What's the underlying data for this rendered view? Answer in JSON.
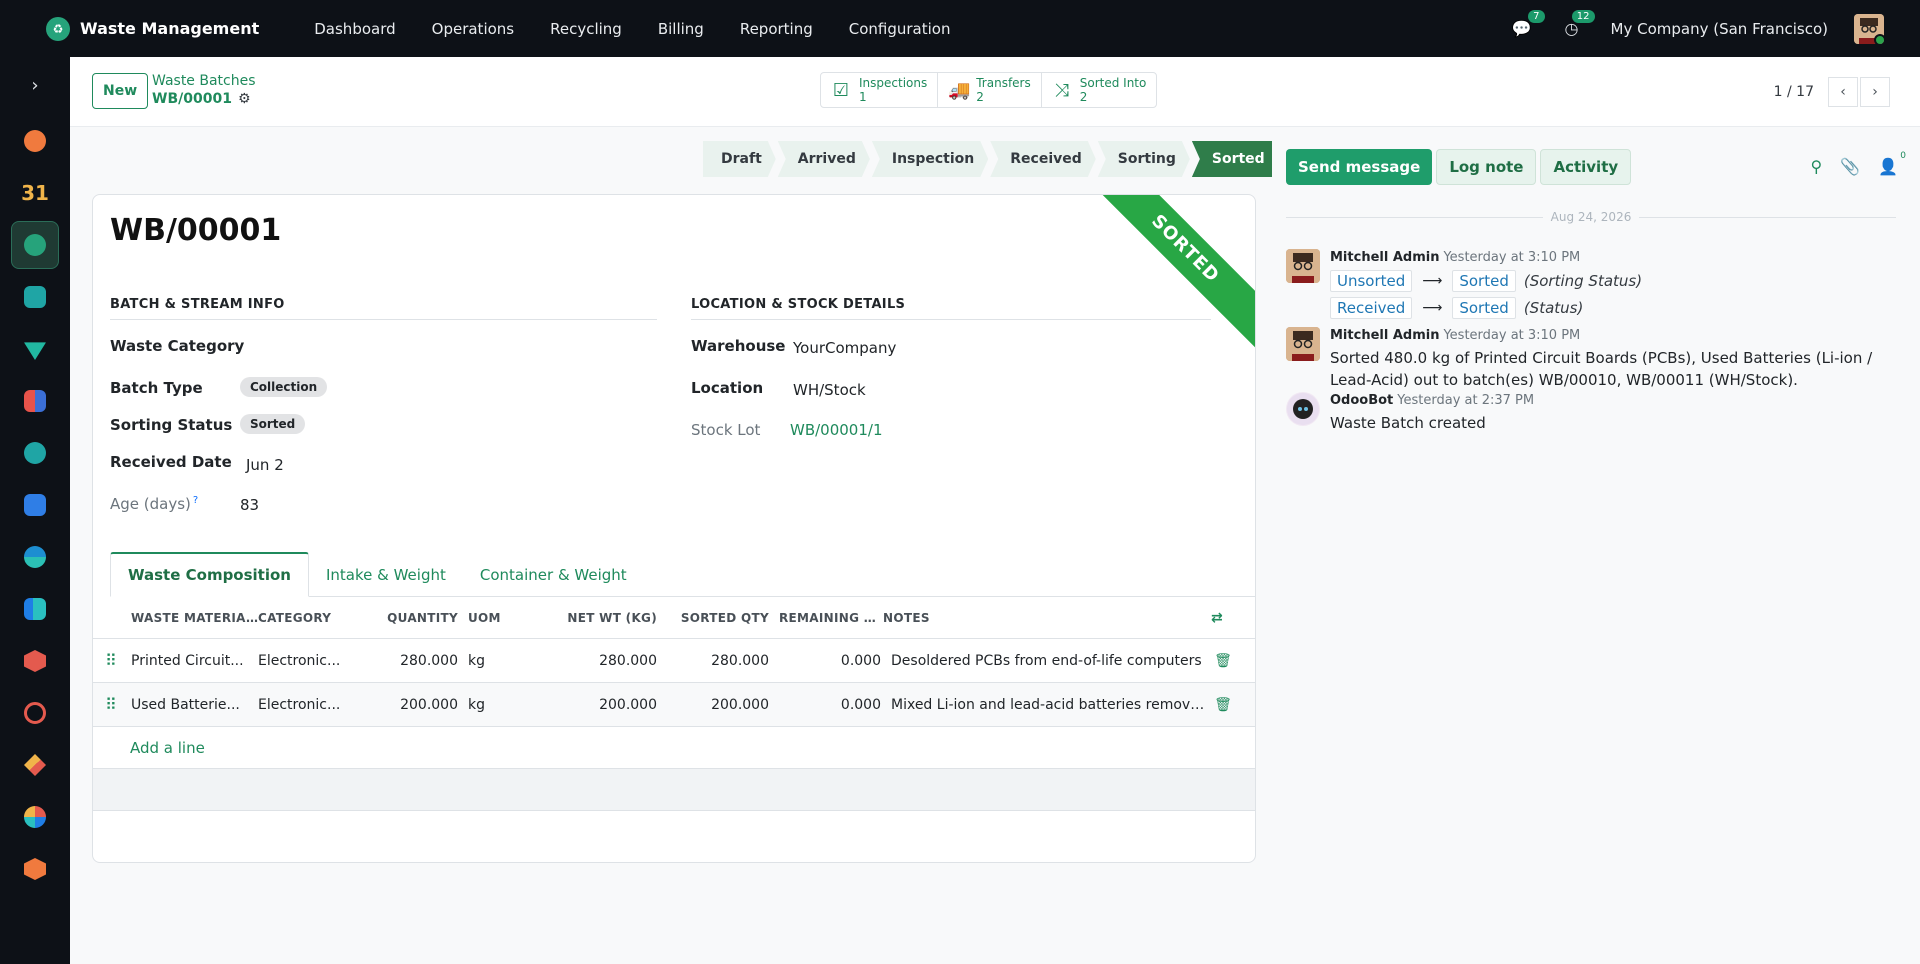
{
  "app": {
    "name": "Waste Management"
  },
  "menu": [
    "Dashboard",
    "Operations",
    "Recycling",
    "Billing",
    "Reporting",
    "Configuration"
  ],
  "systray": {
    "messages_count": "7",
    "activities_count": "12",
    "company": "My Company (San Francisco)"
  },
  "control_panel": {
    "new_label": "New",
    "breadcrumb_parent": "Waste Batches",
    "breadcrumb_current": "WB/00001",
    "smart_buttons": [
      {
        "label": "Inspections",
        "value": "1",
        "icon": "check-square-icon"
      },
      {
        "label": "Transfers",
        "value": "2",
        "icon": "truck-icon"
      },
      {
        "label": "Sorted Into",
        "value": "2",
        "icon": "shuffle-icon"
      }
    ],
    "pager": "1 / 17"
  },
  "statusbar": [
    "Draft",
    "Arrived",
    "Inspection",
    "Received",
    "Sorting",
    "Sorted"
  ],
  "statusbar_active": "Sorted",
  "record": {
    "title": "WB/00001",
    "ribbon": "SORTED",
    "section_left": "BATCH & STREAM INFO",
    "section_right": "LOCATION & STOCK DETAILS",
    "fields_left": {
      "waste_category_label": "Waste Category",
      "batch_type_label": "Batch Type",
      "batch_type_value": "Collection",
      "sorting_status_label": "Sorting Status",
      "sorting_status_value": "Sorted",
      "received_date_label": "Received Date",
      "received_date_value": "Jun 2",
      "age_label": "Age (days)",
      "age_help": "?",
      "age_value": "83"
    },
    "fields_right": {
      "warehouse_label": "Warehouse",
      "warehouse_value": "YourCompany",
      "location_label": "Location",
      "location_value": "WH/Stock",
      "stock_lot_label": "Stock Lot",
      "stock_lot_value": "WB/00001/1"
    }
  },
  "tabs": [
    "Waste Composition",
    "Intake & Weight",
    "Container & Weight"
  ],
  "table": {
    "headers": [
      "WASTE MATERIA...",
      "CATEGORY",
      "QUANTITY",
      "UOM",
      "NET WT (KG)",
      "SORTED QTY",
      "REMAINING T...",
      "NOTES"
    ],
    "rows": [
      {
        "material": "Printed Circuit...",
        "category": "Electronic...",
        "quantity": "280.000",
        "uom": "kg",
        "net_wt": "280.000",
        "sorted_qty": "280.000",
        "remaining": "0.000",
        "notes": "Desoldered PCBs from end-of-life computers"
      },
      {
        "material": "Used Batterie...",
        "category": "Electronic...",
        "quantity": "200.000",
        "uom": "kg",
        "net_wt": "200.000",
        "sorted_qty": "200.000",
        "remaining": "0.000",
        "notes": "Mixed Li-ion and lead-acid batteries remove..."
      }
    ],
    "add_line": "Add a line"
  },
  "chatter": {
    "send_message": "Send message",
    "log_note": "Log note",
    "activity": "Activity",
    "followers_count": "0",
    "date_separator": "Aug 24, 2026",
    "messages": [
      {
        "author": "Mitchell Admin",
        "time": "Yesterday at 3:10 PM",
        "tracking": [
          {
            "old": "Unsorted",
            "new": "Sorted",
            "field": "(Sorting Status)"
          },
          {
            "old": "Received",
            "new": "Sorted",
            "field": "(Status)"
          }
        ]
      },
      {
        "author": "Mitchell Admin",
        "time": "Yesterday at 3:10 PM",
        "text": "Sorted 480.0 kg of Printed Circuit Boards (PCBs), Used Batteries (Li-ion / Lead-Acid) out to batch(es) WB/00010, WB/00011 (WH/Stock)."
      },
      {
        "author": "OdooBot",
        "time": "Yesterday at 2:37 PM",
        "text": "Waste Batch created"
      }
    ]
  },
  "colors": {
    "primary": "#1f8a5c",
    "topbar": "#0d1117",
    "ribbon": "#28a745",
    "status_active": "#2f7d4a"
  }
}
